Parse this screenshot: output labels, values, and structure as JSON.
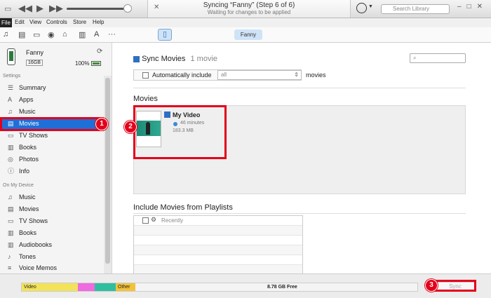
{
  "titlebar": {
    "now_playing_title": "Syncing “Fanny” (Step 6 of 6)",
    "now_playing_subtitle": "Waiting for changes to be applied",
    "search_placeholder": "Search Library"
  },
  "menu": [
    "File",
    "Edit",
    "View",
    "Controls",
    "Store",
    "Help"
  ],
  "toolbar": {
    "media_icons": [
      "music-icon",
      "movies-icon",
      "tv-icon",
      "podcasts-icon",
      "itunes-u-icon",
      "books-icon",
      "apps-icon",
      "more-icon"
    ],
    "device_tab_label": "Fanny"
  },
  "device": {
    "name": "Fanny",
    "capacity": "16GB",
    "battery": "100%"
  },
  "sidebar": {
    "settings_label": "Settings",
    "settings_items": [
      {
        "label": "Summary",
        "icon": "summary-icon"
      },
      {
        "label": "Apps",
        "icon": "apps-icon"
      },
      {
        "label": "Music",
        "icon": "music-icon"
      },
      {
        "label": "Movies",
        "icon": "movies-icon",
        "selected": true
      },
      {
        "label": "TV Shows",
        "icon": "tv-icon"
      },
      {
        "label": "Books",
        "icon": "books-icon"
      },
      {
        "label": "Photos",
        "icon": "photos-icon"
      },
      {
        "label": "Info",
        "icon": "info-icon"
      }
    ],
    "ondevice_label": "On My Device",
    "ondevice_items": [
      {
        "label": "Music",
        "icon": "music-icon"
      },
      {
        "label": "Movies",
        "icon": "movies-icon"
      },
      {
        "label": "TV Shows",
        "icon": "tv-icon"
      },
      {
        "label": "Books",
        "icon": "books-icon"
      },
      {
        "label": "Audiobooks",
        "icon": "audiobooks-icon"
      },
      {
        "label": "Tones",
        "icon": "tones-icon"
      },
      {
        "label": "Voice Memos",
        "icon": "voice-memos-icon"
      }
    ]
  },
  "main": {
    "sync_label": "Sync Movies",
    "sync_count": "1 movie",
    "sync_checked": true,
    "auto_include_label": "Automatically include",
    "auto_include_value": "all",
    "auto_include_suffix": "movies",
    "movies_heading": "Movies",
    "movie": {
      "title": "My Video",
      "duration": "46 minutes",
      "size": "183.3 MB",
      "checked": true
    },
    "playlists_heading": "Include Movies from Playlists",
    "playlists": [
      {
        "label": "Recently"
      }
    ]
  },
  "capacity_bar": {
    "segments": [
      {
        "label": "Video",
        "color": "#f2e35a"
      },
      {
        "label": "",
        "color": "#f06ae0"
      },
      {
        "label": "",
        "color": "#2fbf9f"
      },
      {
        "label": "Other",
        "color": "#f2c33a"
      }
    ],
    "free_label": "8.78 GB Free",
    "sync_button": "Sync"
  },
  "callouts": [
    "1",
    "2",
    "3"
  ],
  "colors": {
    "selection": "#1f6fd8",
    "callout": "#e3001b"
  }
}
